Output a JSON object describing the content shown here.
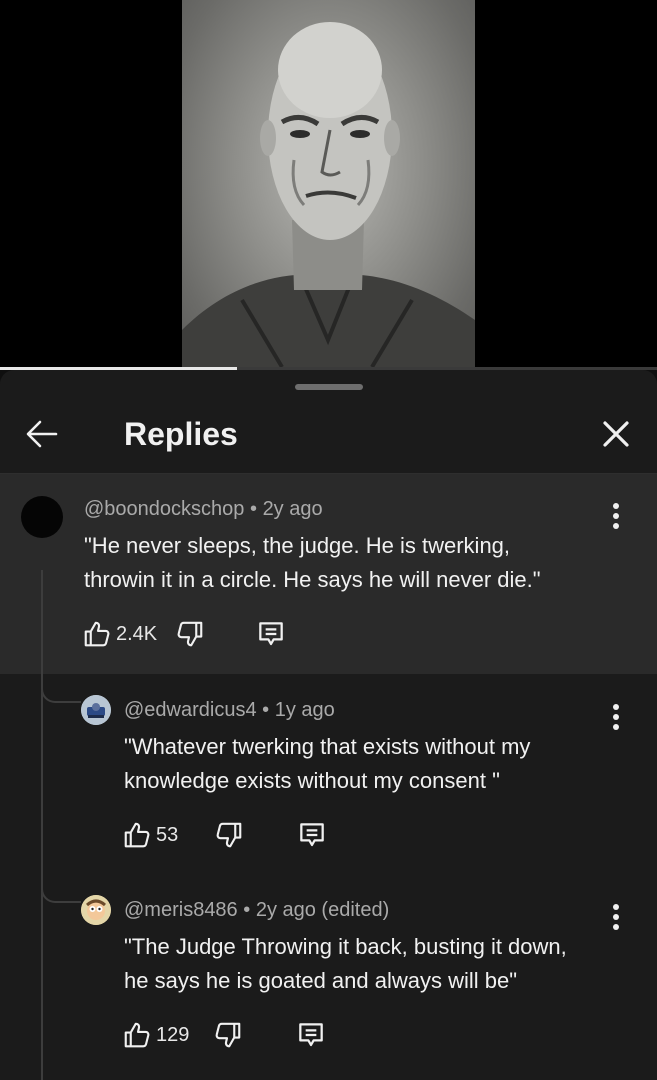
{
  "video": {
    "progress_fraction": 0.36
  },
  "panel": {
    "title": "Replies"
  },
  "parent_comment": {
    "handle": "@boondockschop",
    "age": "2y ago",
    "text_line1": "\"He never sleeps, the judge. He is twerking,",
    "text_line2": "throwin it in a circle. He says he will never die.\"",
    "likes": "2.4K"
  },
  "replies": [
    {
      "handle": "@edwardicus4",
      "age": "1y ago",
      "text_line1": "\"Whatever twerking that exists without my",
      "text_line2": "knowledge exists without my consent \"",
      "likes": "53"
    },
    {
      "handle": "@meris8486",
      "age": "2y ago (edited)",
      "text_line1": "\"The Judge Throwing it back, busting it down,",
      "text_line2": "he says he is goated and always will be\"",
      "likes": "129"
    }
  ],
  "separator": "•",
  "icons": {
    "back": "arrow-left-icon",
    "close": "close-icon",
    "more": "more-vertical-icon",
    "like": "thumbs-up-icon",
    "dislike": "thumbs-down-icon",
    "reply": "comment-icon"
  },
  "colors": {
    "background": "#0f0f0f",
    "sheet": "#1b1b1b",
    "highlight": "#2a2a2a",
    "secondary_text": "#aaaaaa"
  }
}
